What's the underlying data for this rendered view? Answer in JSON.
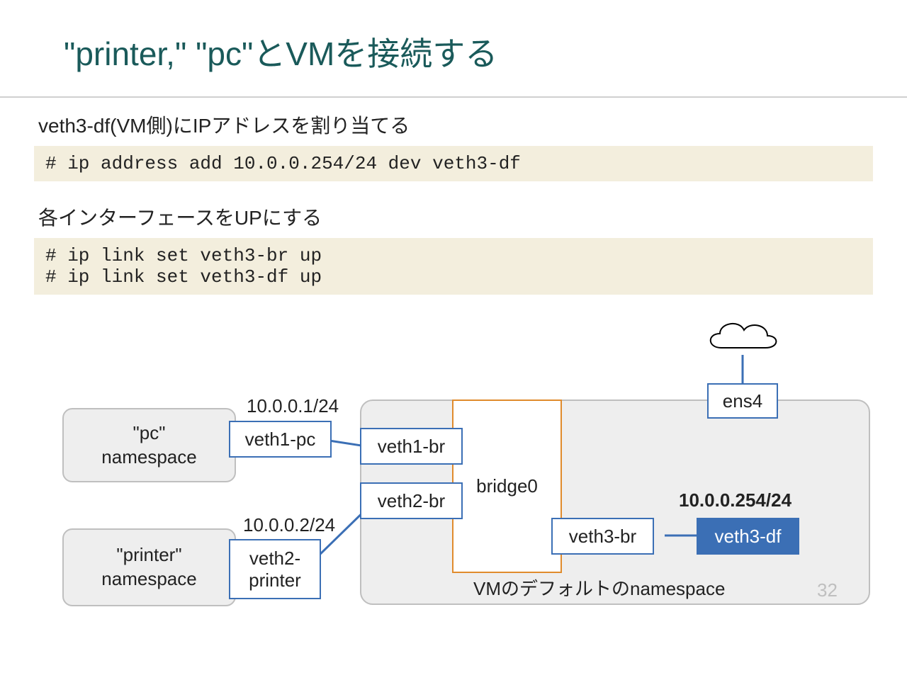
{
  "title": "\"printer,\" \"pc\"とVMを接続する",
  "para1": "veth3-df(VM側)にIPアドレスを割り当てる",
  "code1": "# ip address add 10.0.0.254/24 dev veth3-df",
  "para2": "各インターフェースをUPにする",
  "code2": "# ip link set veth3-br up\n# ip link set veth3-df up",
  "diagram": {
    "pc_ns": "\"pc\"\nnamespace",
    "printer_ns": "\"printer\"\nnamespace",
    "veth1_pc": "veth1-pc",
    "veth2_printer": "veth2-\nprinter",
    "veth1_br": "veth1-br",
    "veth2_br": "veth2-br",
    "bridge0": "bridge0",
    "veth3_br": "veth3-br",
    "veth3_df": "veth3-df",
    "ens4": "ens4",
    "ip1": "10.0.0.1/24",
    "ip2": "10.0.0.2/24",
    "ip3": "10.0.0.254/24",
    "vm_caption": "VMのデフォルトのnamespace"
  },
  "page_number": "32"
}
